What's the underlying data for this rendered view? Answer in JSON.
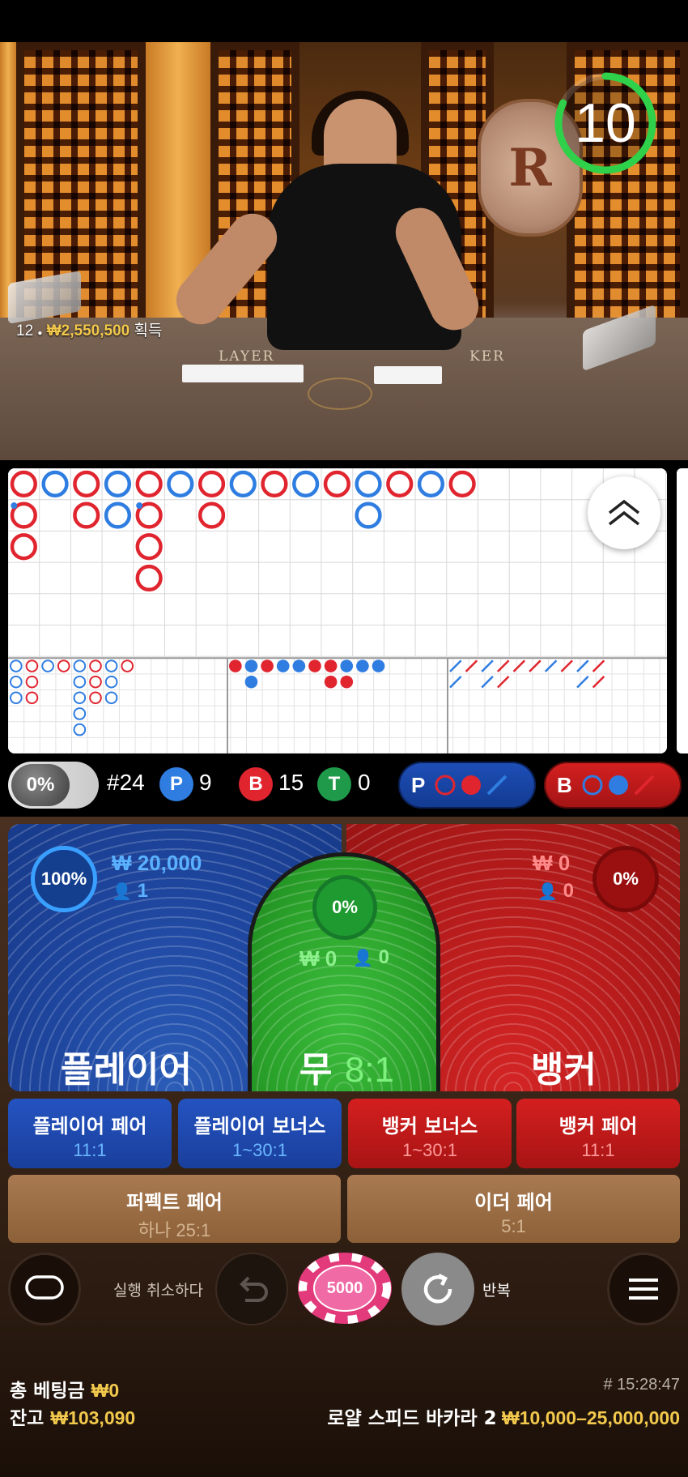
{
  "timer": {
    "seconds": "10",
    "progress": 0.82
  },
  "video": {
    "winner_seat": "12",
    "winner_amount": "₩2,550,500",
    "winner_suffix": "획득",
    "table_left_text": "LAYER",
    "table_right_text": "KER"
  },
  "roadmap": {
    "big_road": [
      {
        "col": 0,
        "row": 0,
        "c": "B"
      },
      {
        "col": 0,
        "row": 1,
        "c": "B",
        "pair": "P"
      },
      {
        "col": 0,
        "row": 2,
        "c": "B"
      },
      {
        "col": 1,
        "row": 0,
        "c": "P"
      },
      {
        "col": 2,
        "row": 0,
        "c": "B"
      },
      {
        "col": 2,
        "row": 1,
        "c": "B"
      },
      {
        "col": 3,
        "row": 0,
        "c": "P"
      },
      {
        "col": 3,
        "row": 1,
        "c": "P"
      },
      {
        "col": 4,
        "row": 0,
        "c": "B"
      },
      {
        "col": 4,
        "row": 1,
        "c": "B",
        "pair": "P"
      },
      {
        "col": 4,
        "row": 2,
        "c": "B"
      },
      {
        "col": 4,
        "row": 3,
        "c": "B"
      },
      {
        "col": 5,
        "row": 0,
        "c": "P"
      },
      {
        "col": 6,
        "row": 0,
        "c": "B"
      },
      {
        "col": 6,
        "row": 1,
        "c": "B"
      },
      {
        "col": 7,
        "row": 0,
        "c": "P"
      },
      {
        "col": 8,
        "row": 0,
        "c": "B"
      },
      {
        "col": 9,
        "row": 0,
        "c": "P"
      },
      {
        "col": 10,
        "row": 0,
        "c": "B"
      },
      {
        "col": 11,
        "row": 0,
        "c": "P"
      },
      {
        "col": 11,
        "row": 1,
        "c": "P"
      },
      {
        "col": 12,
        "row": 0,
        "c": "B"
      },
      {
        "col": 13,
        "row": 0,
        "c": "P"
      },
      {
        "col": 14,
        "row": 0,
        "c": "B"
      }
    ],
    "big_eye": [
      {
        "col": 0,
        "row": 0,
        "c": "P"
      },
      {
        "col": 0,
        "row": 1,
        "c": "P"
      },
      {
        "col": 0,
        "row": 2,
        "c": "P"
      },
      {
        "col": 1,
        "row": 0,
        "c": "B"
      },
      {
        "col": 1,
        "row": 1,
        "c": "B"
      },
      {
        "col": 1,
        "row": 2,
        "c": "B"
      },
      {
        "col": 2,
        "row": 0,
        "c": "P"
      },
      {
        "col": 3,
        "row": 0,
        "c": "B"
      },
      {
        "col": 4,
        "row": 0,
        "c": "P"
      },
      {
        "col": 4,
        "row": 1,
        "c": "P"
      },
      {
        "col": 4,
        "row": 2,
        "c": "P"
      },
      {
        "col": 4,
        "row": 3,
        "c": "P"
      },
      {
        "col": 4,
        "row": 4,
        "c": "P"
      },
      {
        "col": 5,
        "row": 0,
        "c": "B"
      },
      {
        "col": 5,
        "row": 1,
        "c": "B"
      },
      {
        "col": 5,
        "row": 2,
        "c": "B"
      },
      {
        "col": 6,
        "row": 0,
        "c": "P"
      },
      {
        "col": 6,
        "row": 1,
        "c": "P"
      },
      {
        "col": 6,
        "row": 2,
        "c": "P"
      },
      {
        "col": 7,
        "row": 0,
        "c": "B"
      }
    ],
    "small_road": [
      {
        "col": 0,
        "row": 0,
        "c": "B"
      },
      {
        "col": 1,
        "row": 0,
        "c": "P"
      },
      {
        "col": 1,
        "row": 1,
        "c": "P"
      },
      {
        "col": 2,
        "row": 0,
        "c": "B"
      },
      {
        "col": 3,
        "row": 0,
        "c": "P"
      },
      {
        "col": 4,
        "row": 0,
        "c": "P"
      },
      {
        "col": 5,
        "row": 0,
        "c": "B"
      },
      {
        "col": 6,
        "row": 0,
        "c": "B"
      },
      {
        "col": 6,
        "row": 1,
        "c": "B"
      },
      {
        "col": 7,
        "row": 0,
        "c": "P"
      },
      {
        "col": 7,
        "row": 1,
        "c": "B"
      },
      {
        "col": 8,
        "row": 0,
        "c": "P"
      },
      {
        "col": 9,
        "row": 0,
        "c": "P"
      }
    ],
    "cockroach": [
      {
        "col": 0,
        "row": 0,
        "c": "P"
      },
      {
        "col": 0,
        "row": 1,
        "c": "P"
      },
      {
        "col": 1,
        "row": 0,
        "c": "B"
      },
      {
        "col": 2,
        "row": 0,
        "c": "P"
      },
      {
        "col": 2,
        "row": 1,
        "c": "P"
      },
      {
        "col": 3,
        "row": 0,
        "c": "B"
      },
      {
        "col": 3,
        "row": 1,
        "c": "B"
      },
      {
        "col": 4,
        "row": 0,
        "c": "B"
      },
      {
        "col": 5,
        "row": 0,
        "c": "B"
      },
      {
        "col": 6,
        "row": 0,
        "c": "P"
      },
      {
        "col": 7,
        "row": 0,
        "c": "B"
      },
      {
        "col": 8,
        "row": 0,
        "c": "P"
      },
      {
        "col": 8,
        "row": 1,
        "c": "P"
      },
      {
        "col": 9,
        "row": 0,
        "c": "B"
      },
      {
        "col": 9,
        "row": 1,
        "c": "B"
      }
    ]
  },
  "stats": {
    "percent": "0%",
    "round": "#24",
    "player_letter": "P",
    "player_count": "9",
    "banker_letter": "B",
    "banker_count": "15",
    "tie_letter": "T",
    "tie_count": "0",
    "ask_player": "P",
    "ask_banker": "B"
  },
  "bets": {
    "player": {
      "percent": "100%",
      "amount": "₩ 20,000",
      "users": "1",
      "label": "플레이어"
    },
    "tie": {
      "percent": "0%",
      "amount": "₩ 0",
      "users": "0",
      "label": "무",
      "odds": "8:1"
    },
    "banker": {
      "percent": "0%",
      "amount": "₩ 0",
      "users": "0",
      "label": "뱅커"
    },
    "side": [
      {
        "label": "플레이어 페어",
        "odds": "11:1"
      },
      {
        "label": "플레이어 보너스",
        "odds": "1~30:1"
      },
      {
        "label": "뱅커 보너스",
        "odds": "1~30:1"
      },
      {
        "label": "뱅커 페어",
        "odds": "11:1"
      }
    ],
    "perfect_pair": {
      "label": "퍼펙트 페어",
      "odds": "하나 25:1"
    },
    "either_pair": {
      "label": "이더 페어",
      "odds": "5:1"
    }
  },
  "controls": {
    "undo_label": "실행 취소하다",
    "chip_value": "5000",
    "repeat_label": "반복"
  },
  "footer": {
    "total_bet_label": "총 베팅금",
    "total_bet_value": "₩0",
    "balance_label": "잔고",
    "balance_value": "₩103,090",
    "time": "# 15:28:47",
    "table_name": "로얄 스피드 바카라 2",
    "limits": "₩10,000–25,000,000"
  },
  "colors": {
    "player": "#2f7de1",
    "banker": "#e0252f",
    "tie": "#1f9a4a",
    "gold": "#f2c94c"
  }
}
